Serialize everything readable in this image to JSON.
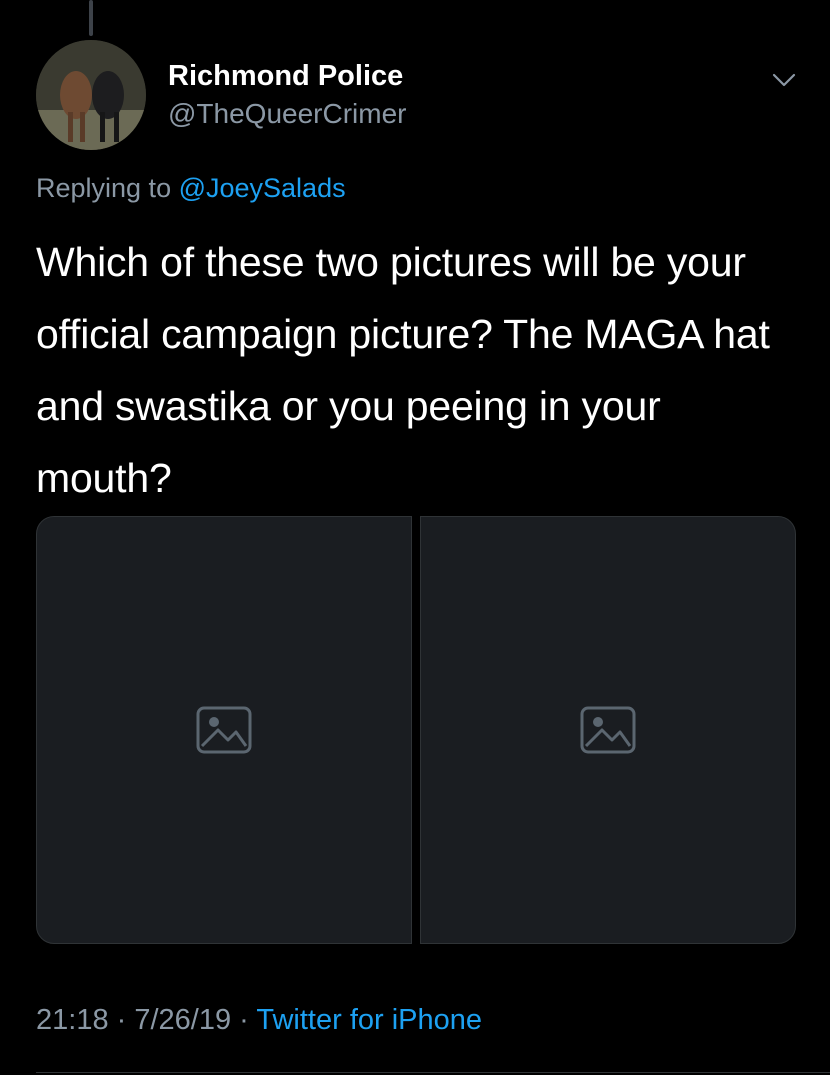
{
  "tweet": {
    "author": {
      "display_name": "Richmond Police",
      "handle": "@TheQueerCrimer"
    },
    "reply": {
      "prefix": "Replying to ",
      "mention": "@JoeySalads"
    },
    "text": "Which of these two pictures will be your official campaign picture? The MAGA hat and swastika or you peeing in your mouth?",
    "media": [
      {
        "icon": "image-icon"
      },
      {
        "icon": "image-icon"
      }
    ],
    "footer": {
      "time": "21:18",
      "separator": " · ",
      "date": "7/26/19",
      "source": "Twitter for iPhone"
    }
  },
  "colors": {
    "background": "#000000",
    "primary_text": "#ffffff",
    "secondary_text": "#8b98a5",
    "accent": "#1da1f2",
    "divider": "#2f3336"
  }
}
